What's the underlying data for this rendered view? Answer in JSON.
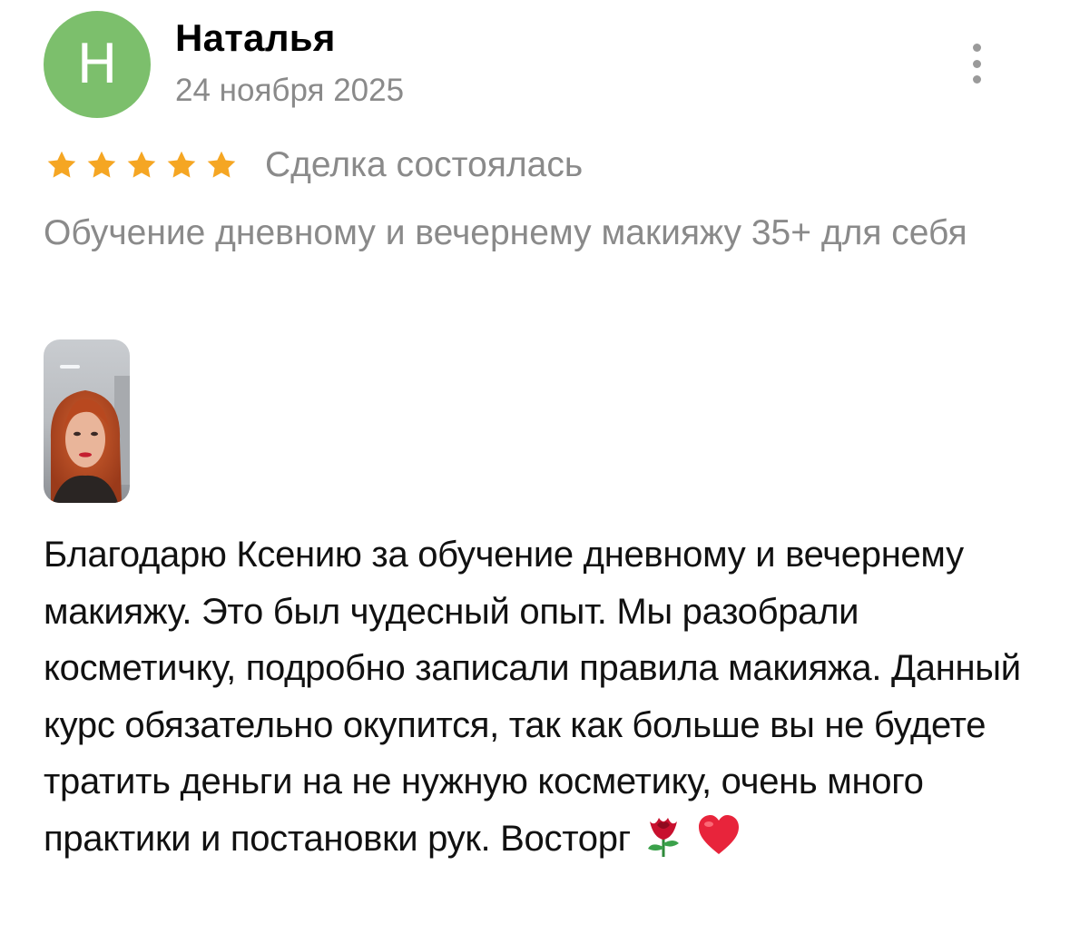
{
  "review": {
    "author": {
      "initial": "Н",
      "name": "Наталья",
      "avatar_color": "#7cbf6c"
    },
    "date": "24 ноября 2025",
    "rating": 5,
    "deal_status": "Сделка состоялась",
    "service": "Обучение дневному и вечернему макияжу 35+ для себя",
    "text": "Благодарю Ксению за обучение дневному и вечернему макияжу. Это был чудесный опыт. Мы разобрали косметичку, подробно записали правила макияжа. Данный курс обязательно окупится, так как больше вы не будете тратить деньги на не нужную косметику, очень много практики и постановки рук. Восторг",
    "emojis": [
      "rose-icon",
      "heart-icon"
    ],
    "colors": {
      "star": "#f5a623",
      "secondary_text": "#8a8a8a",
      "primary_text": "#111111"
    }
  }
}
